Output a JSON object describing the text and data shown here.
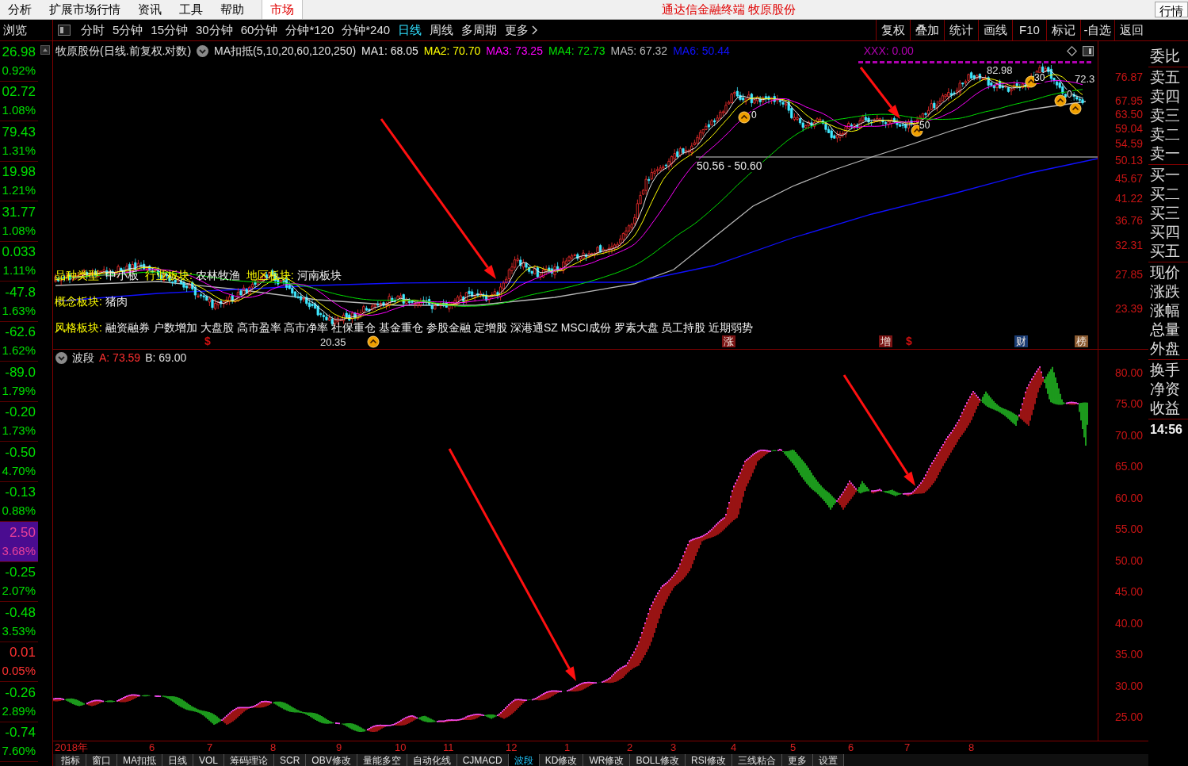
{
  "menu": {
    "items": [
      {
        "label": "分析",
        "selected": false
      },
      {
        "label": "扩展市场行情",
        "selected": false
      },
      {
        "label": "资讯",
        "selected": false
      },
      {
        "label": "工具",
        "selected": false
      },
      {
        "label": "帮助",
        "selected": false
      },
      {
        "label": "市场",
        "selected": true
      }
    ],
    "title": "通达信金融终端 牧原股份",
    "right_button": "行情"
  },
  "browse": {
    "header": "浏览",
    "items": [
      {
        "value": "26.98",
        "change": "0.92%",
        "color": "#00e000",
        "selected": false
      },
      {
        "value": "02.72",
        "change": "1.08%",
        "color": "#00e000",
        "selected": false
      },
      {
        "value": "79.43",
        "change": "1.31%",
        "color": "#00e000",
        "selected": false
      },
      {
        "value": "19.98",
        "change": "1.21%",
        "color": "#00e000",
        "selected": false
      },
      {
        "value": "31.77",
        "change": "1.08%",
        "color": "#00e000",
        "selected": false
      },
      {
        "value": "0.033",
        "change": "1.11%",
        "color": "#00e000",
        "selected": false
      },
      {
        "value": "-47.8",
        "change": "1.63%",
        "color": "#00e000",
        "selected": false
      },
      {
        "value": "-62.6",
        "change": "1.62%",
        "color": "#00e000",
        "selected": false
      },
      {
        "value": "-89.0",
        "change": "1.79%",
        "color": "#00e000",
        "selected": false
      },
      {
        "value": "-0.20",
        "change": "1.73%",
        "color": "#00e000",
        "selected": false
      },
      {
        "value": "-0.50",
        "change": "4.70%",
        "color": "#00e000",
        "selected": false
      },
      {
        "value": "-0.13",
        "change": "0.88%",
        "color": "#00e000",
        "selected": false
      },
      {
        "value": "2.50",
        "change": "3.68%",
        "color": "#e8409a",
        "selected": true
      },
      {
        "value": "-0.25",
        "change": "2.07%",
        "color": "#00e000",
        "selected": false
      },
      {
        "value": "-0.48",
        "change": "3.53%",
        "color": "#00e000",
        "selected": false
      },
      {
        "value": "0.01",
        "change": "0.05%",
        "color": "#ff3232",
        "selected": false
      },
      {
        "value": "-0.26",
        "change": "2.89%",
        "color": "#00e000",
        "selected": false
      },
      {
        "value": "-0.74",
        "change": "7.60%",
        "color": "#00e000",
        "selected": false
      }
    ]
  },
  "toolbar": {
    "periods": [
      {
        "label": "分时",
        "selected": false
      },
      {
        "label": "5分钟",
        "selected": false
      },
      {
        "label": "15分钟",
        "selected": false
      },
      {
        "label": "30分钟",
        "selected": false
      },
      {
        "label": "60分钟",
        "selected": false
      },
      {
        "label": "分钟*120",
        "selected": false
      },
      {
        "label": "分钟*240",
        "selected": false
      },
      {
        "label": "日线",
        "selected": true
      },
      {
        "label": "周线",
        "selected": false
      },
      {
        "label": "多周期",
        "selected": false
      }
    ],
    "more": "更多",
    "buttons": [
      "复权",
      "叠加",
      "统计",
      "画线",
      "F10",
      "标记",
      "-自选",
      "返回"
    ]
  },
  "main_chart": {
    "title": "牧原股份(日线.前复权.对数)",
    "indicator": "MA扣抵(5,10,20,60,120,250)",
    "ma": [
      {
        "label": "MA1: 68.05",
        "color": "#e8e8e8"
      },
      {
        "label": "MA2: 70.70",
        "color": "#ffff00"
      },
      {
        "label": "MA3: 73.25",
        "color": "#ff00ff"
      },
      {
        "label": "MA4: 72.73",
        "color": "#00e000"
      },
      {
        "label": "MA5: 67.32",
        "color": "#b8b8b8"
      },
      {
        "label": "MA6: 50.44",
        "color": "#1010ff"
      }
    ],
    "signal": {
      "label": "XXX: 0.00",
      "color": "#b000b0"
    },
    "price_labels": [
      "82.98",
      "72.3",
      "20.35"
    ],
    "level_label": "50.56 - 50.60",
    "marker_labels": [
      "0",
      "50",
      "30",
      "0"
    ],
    "info_rows": [
      [
        {
          "label": "品种类型:",
          "value": "中小板"
        },
        {
          "label": "行业板块:",
          "value": "农林牧渔"
        },
        {
          "label": "地区板块:",
          "value": "河南板块"
        }
      ],
      [
        {
          "label": "概念板块:",
          "value": "猪肉"
        }
      ],
      [
        {
          "label": "风格板块:",
          "value": "融资融券 户数增加 大盘股 高市盈率 高市净率 社保重仓 基金重仓 参股金融 定增股 深港通SZ MSCI成份 罗素大盘 员工持股 近期弱势"
        }
      ]
    ],
    "event_marks": [
      {
        "kind": "letter",
        "label": "$",
        "color": "#d01010"
      },
      {
        "kind": "tag",
        "label": "涨",
        "color": "#7a1414"
      },
      {
        "kind": "tag",
        "label": "增",
        "color": "#7a1414"
      },
      {
        "kind": "letter",
        "label": "$",
        "color": "#d01010"
      },
      {
        "kind": "tag",
        "label": "财",
        "color": "#1a3c74"
      },
      {
        "kind": "tag",
        "label": "榜",
        "color": "#8a5a30"
      }
    ],
    "axis": [
      "76.87",
      "67.95",
      "63.50",
      "59.04",
      "54.59",
      "50.13",
      "45.67",
      "41.22",
      "36.76",
      "32.31",
      "27.85",
      "23.39"
    ]
  },
  "wave_panel": {
    "title": "波段",
    "values": [
      {
        "label": "A: 73.59",
        "color": "#ff3030"
      },
      {
        "label": "B: 69.00",
        "color": "#e0e0e0"
      }
    ],
    "axis": [
      "80.00",
      "75.00",
      "70.00",
      "65.00",
      "60.00",
      "55.00",
      "50.00",
      "45.00",
      "40.00",
      "35.00",
      "30.00",
      "25.00"
    ]
  },
  "date_axis": [
    "2018年",
    "6",
    "7",
    "8",
    "9",
    "10",
    "11",
    "12",
    "1",
    "2",
    "3",
    "4",
    "5",
    "6",
    "7",
    "8"
  ],
  "bottom_tabs": [
    {
      "label": "指标",
      "selected": false
    },
    {
      "label": "窗口",
      "selected": false
    },
    {
      "label": "MA扣抵",
      "selected": false
    },
    {
      "label": "日线",
      "selected": false
    },
    {
      "label": "VOL",
      "selected": false
    },
    {
      "label": "筹码理论",
      "selected": false
    },
    {
      "label": "SCR",
      "selected": false
    },
    {
      "label": "OBV修改",
      "selected": false
    },
    {
      "label": "量能多空",
      "selected": false
    },
    {
      "label": "自动化线",
      "selected": false
    },
    {
      "label": "CJMACD",
      "selected": false
    },
    {
      "label": "波段",
      "selected": true
    },
    {
      "label": "KD修改",
      "selected": false
    },
    {
      "label": "WR修改",
      "selected": false
    },
    {
      "label": "BOLL修改",
      "selected": false
    },
    {
      "label": "RSI修改",
      "selected": false
    },
    {
      "label": "三线粘合",
      "selected": false
    },
    {
      "label": "更多",
      "selected": false
    },
    {
      "label": "设置",
      "selected": false
    }
  ],
  "quote_panel": {
    "groups": [
      [
        "委比"
      ],
      [
        "卖五",
        "卖四",
        "卖三",
        "卖二",
        "卖一"
      ],
      [
        "买一",
        "买二",
        "买三",
        "买四",
        "买五"
      ],
      [
        "现价",
        "涨跌",
        "涨幅",
        "总量",
        "外盘"
      ],
      [
        "换手",
        "净资",
        "收益"
      ]
    ],
    "time": "14:56"
  }
}
